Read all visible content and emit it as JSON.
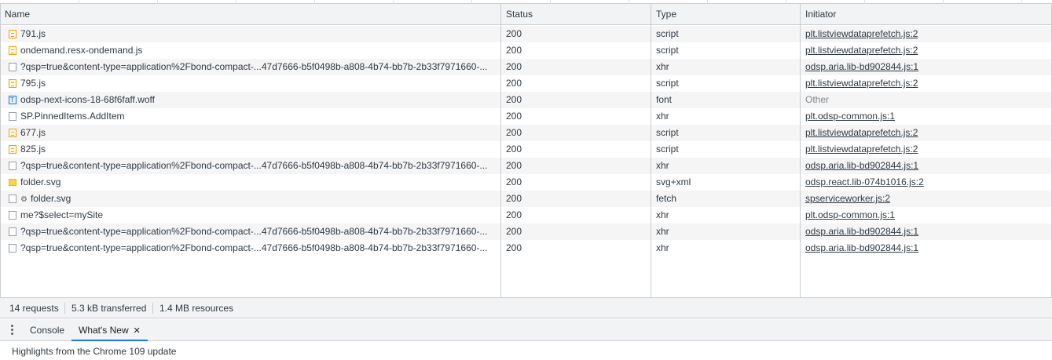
{
  "columns": {
    "name": "Name",
    "status": "Status",
    "type": "Type",
    "initiator": "Initiator"
  },
  "rows": [
    {
      "icon": "script-file-icon",
      "name": "791.js",
      "status": "200",
      "type": "script",
      "initiator": "plt.listviewdataprefetch.js:2"
    },
    {
      "icon": "script-file-icon",
      "name": "ondemand.resx-ondemand.js",
      "status": "200",
      "type": "script",
      "initiator": "plt.listviewdataprefetch.js:2"
    },
    {
      "icon": "document-icon",
      "name": "?qsp=true&content-type=application%2Fbond-compact-...47d7666-b5f0498b-a808-4b74-bb7b-2b33f7971660-...",
      "status": "200",
      "type": "xhr",
      "initiator": "odsp.aria.lib-bd902844.js:1"
    },
    {
      "icon": "script-file-icon",
      "name": "795.js",
      "status": "200",
      "type": "script",
      "initiator": "plt.listviewdataprefetch.js:2"
    },
    {
      "icon": "font-file-icon",
      "name": "odsp-next-icons-18-68f6faff.woff",
      "status": "200",
      "type": "font",
      "initiator": "Other"
    },
    {
      "icon": "document-icon",
      "name": "SP.PinnedItems.AddItem",
      "status": "200",
      "type": "xhr",
      "initiator": "plt.odsp-common.js:1"
    },
    {
      "icon": "script-file-icon",
      "name": "677.js",
      "status": "200",
      "type": "script",
      "initiator": "plt.listviewdataprefetch.js:2"
    },
    {
      "icon": "script-file-icon",
      "name": "825.js",
      "status": "200",
      "type": "script",
      "initiator": "plt.listviewdataprefetch.js:2"
    },
    {
      "icon": "document-icon",
      "name": "?qsp=true&content-type=application%2Fbond-compact-...47d7666-b5f0498b-a808-4b74-bb7b-2b33f7971660-...",
      "status": "200",
      "type": "xhr",
      "initiator": "odsp.aria.lib-bd902844.js:1"
    },
    {
      "icon": "image-file-icon",
      "name": "folder.svg",
      "status": "200",
      "type": "svg+xml",
      "initiator": "odsp.react.lib-074b1016.js:2"
    },
    {
      "icon": "document-icon",
      "name": "folder.svg",
      "gear": "⚙",
      "status": "200",
      "type": "fetch",
      "initiator": "spserviceworker.js:2"
    },
    {
      "icon": "document-icon",
      "name": "me?$select=mySite",
      "status": "200",
      "type": "xhr",
      "initiator": "plt.odsp-common.js:1"
    },
    {
      "icon": "document-icon",
      "name": "?qsp=true&content-type=application%2Fbond-compact-...47d7666-b5f0498b-a808-4b74-bb7b-2b33f7971660-...",
      "status": "200",
      "type": "xhr",
      "initiator": "odsp.aria.lib-bd902844.js:1"
    },
    {
      "icon": "document-icon",
      "name": "?qsp=true&content-type=application%2Fbond-compact-...47d7666-b5f0498b-a808-4b74-bb7b-2b33f7971660-...",
      "status": "200",
      "type": "xhr",
      "initiator": "odsp.aria.lib-bd902844.js:1"
    }
  ],
  "summary": {
    "requests": "14 requests",
    "transferred": "5.3 kB transferred",
    "resources": "1.4 MB resources"
  },
  "drawer": {
    "menu_icon": "more-vertical-icon",
    "tabs": [
      {
        "label": "Console"
      },
      {
        "label": "What's New",
        "close": "✕"
      }
    ],
    "message": "Highlights from the Chrome 109 update"
  },
  "colors": {
    "accent": "#1a73e8",
    "header_bg": "#f1f3f4",
    "stripe_bg": "#f5f5f5",
    "border": "#cbcdd1"
  }
}
